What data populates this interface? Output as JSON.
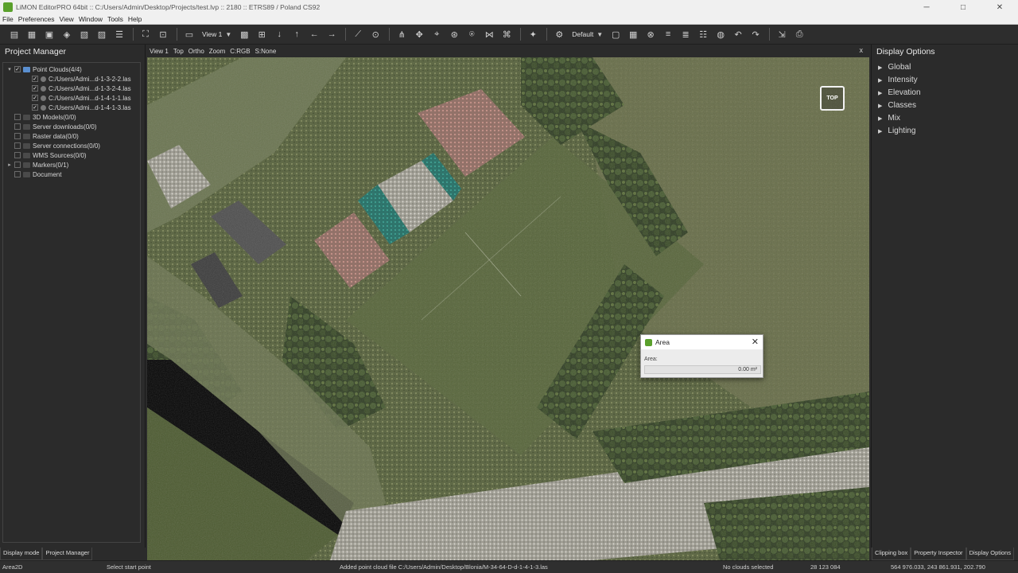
{
  "window": {
    "title": "LiMON EditorPRO 64bit :: C:/Users/Admin/Desktop/Projects/test.lvp :: 2180 :: ETRS89 / Poland CS92",
    "minimize": "─",
    "maximize": "□",
    "close": "✕"
  },
  "menu": [
    "File",
    "Preferences",
    "View",
    "Window",
    "Tools",
    "Help"
  ],
  "toolbar": {
    "view_select": "View 1",
    "style_select": "Default"
  },
  "project_manager": {
    "title": "Project Manager",
    "items": [
      {
        "label": "Point Clouds(4/4)",
        "checked": true,
        "expanded": true
      },
      {
        "label": "C:/Users/Admi...d-1-3-2-2.las",
        "checked": true
      },
      {
        "label": "C:/Users/Admi...d-1-3-2-4.las",
        "checked": true
      },
      {
        "label": "C:/Users/Admi...d-1-4-1-1.las",
        "checked": true
      },
      {
        "label": "C:/Users/Admi...d-1-4-1-3.las",
        "checked": true
      },
      {
        "label": "3D Models(0/0)",
        "checked": false
      },
      {
        "label": "Server downloads(0/0)",
        "checked": false
      },
      {
        "label": "Raster data(0/0)",
        "checked": false
      },
      {
        "label": "Server connections(0/0)",
        "checked": false
      },
      {
        "label": "WMS Sources(0/0)",
        "checked": false
      },
      {
        "label": "Markers(0/1)",
        "checked": false
      },
      {
        "label": "Document",
        "checked": false
      }
    ]
  },
  "view_header": {
    "items": [
      "View 1",
      "Top",
      "Ortho",
      "Zoom",
      "C:RGB",
      "S:None"
    ],
    "close": "x"
  },
  "viewport": {
    "orientation_badge": "TOP"
  },
  "area_dialog": {
    "title": "Area",
    "label": "Area:",
    "value": "0.00 m²",
    "close": "✕"
  },
  "display_options": {
    "title": "Display Options",
    "items": [
      "Global",
      "Intensity",
      "Elevation",
      "Classes",
      "Mix",
      "Lighting"
    ]
  },
  "bottom_tabs_left": [
    "Display mode",
    "Project Manager"
  ],
  "bottom_tabs_right": [
    "Clipping box",
    "Property Inspector",
    "Display Options"
  ],
  "status": {
    "mode": "Area2D",
    "hint": "Select start point",
    "message": "Added point cloud file C:/Users/Admin/Desktop/Blonia/M-34-64-D-d-1-4-1-3.las",
    "selection": "No clouds selected",
    "count": "28 123 084",
    "coords": "564 976.033, 243 861.931, 202.790"
  },
  "colors": {
    "accent": "#5aa02c",
    "panel_bg": "#2b2b2b"
  }
}
